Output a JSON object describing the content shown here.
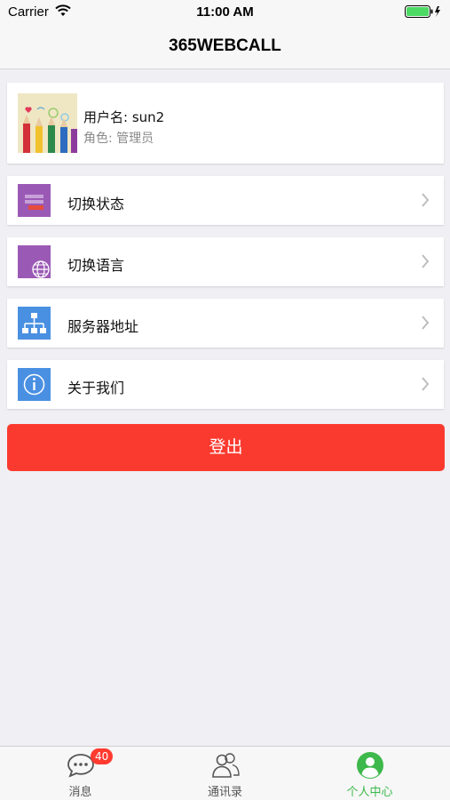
{
  "status_bar": {
    "carrier": "Carrier",
    "time": "11:00 AM"
  },
  "nav": {
    "title": "365WEBCALL"
  },
  "profile": {
    "username": "用户名: sun2",
    "role": "角色: 管理员"
  },
  "menu": [
    {
      "label": "切换状态",
      "icon": "status-icon",
      "color": "#9b59b6"
    },
    {
      "label": "切换语言",
      "icon": "globe-icon",
      "color": "#9b59b6"
    },
    {
      "label": "服务器地址",
      "icon": "network-icon",
      "color": "#4a90e2"
    },
    {
      "label": "关于我们",
      "icon": "info-icon",
      "color": "#4a90e2"
    }
  ],
  "logout": {
    "label": "登出",
    "color": "#fb3a2f"
  },
  "tabs": [
    {
      "label": "消息",
      "icon": "chat-icon",
      "badge": "40"
    },
    {
      "label": "通讯录",
      "icon": "contacts-icon"
    },
    {
      "label": "个人中心",
      "icon": "profile-icon",
      "active": true
    }
  ],
  "colors": {
    "accent_green": "#3db84a"
  }
}
